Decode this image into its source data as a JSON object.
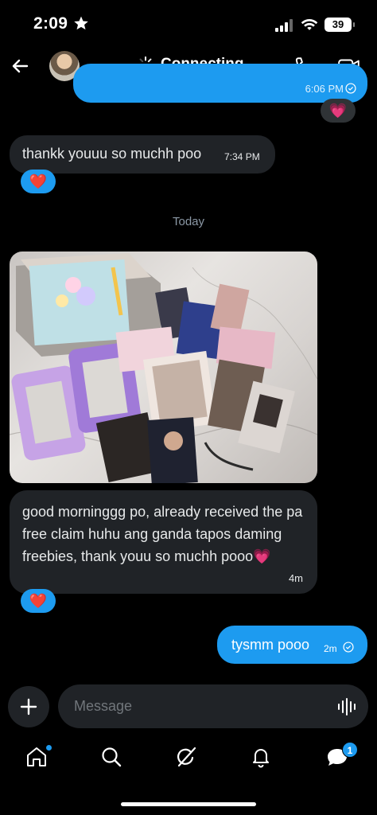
{
  "status_bar": {
    "time": "2:09",
    "battery": "39"
  },
  "header": {
    "connecting_label": "Connecting"
  },
  "messages": [
    {
      "direction": "outgoing",
      "time": "6:06 PM",
      "reaction": "💗"
    },
    {
      "direction": "incoming",
      "text": "thankk youuu so muchh poo",
      "time": "7:34 PM",
      "reaction": "❤️"
    },
    {
      "direction": "incoming",
      "text": "good morninggg po, already received the pa free claim huhu ang ganda tapos daming freebies, thank youu so muchh pooo💗",
      "time": "4m",
      "reaction": "❤️"
    },
    {
      "direction": "outgoing",
      "text": "tysmm pooo",
      "time": "2m"
    }
  ],
  "date_separator": "Today",
  "composer": {
    "placeholder": "Message"
  },
  "tabs": {
    "messages_badge": "1"
  },
  "icons": {
    "back": "arrow-left-icon",
    "call": "phone-icon",
    "video": "video-camera-icon",
    "add": "plus-icon",
    "voice": "waveform-icon",
    "home": "home-icon",
    "search": "search-icon",
    "grok": "grok-icon",
    "notifications": "bell-icon",
    "messages": "message-bubble-icon"
  },
  "colors": {
    "accent": "#1d9bf0",
    "bubble_incoming": "#202327",
    "background": "#000000",
    "muted_text": "#71767b"
  }
}
